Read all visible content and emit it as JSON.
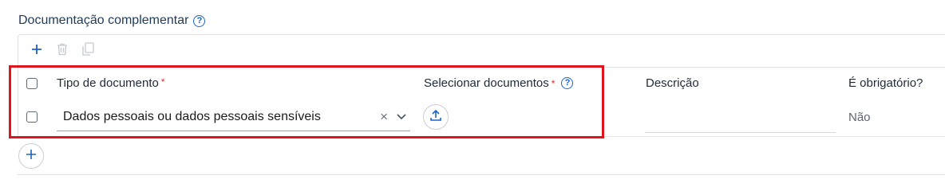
{
  "section": {
    "title": "Documentação complementar",
    "help_icon": "question-circle-icon"
  },
  "toolbar": {
    "add_icon": "plus-icon",
    "delete_icon": "trash-icon",
    "copy_icon": "copy-icon"
  },
  "table": {
    "columns": [
      {
        "label": "Tipo de documento",
        "required": "*"
      },
      {
        "label": "Selecionar documentos",
        "required": "*"
      },
      {
        "label": "Descrição"
      },
      {
        "label": "É obrigatório?"
      }
    ],
    "rows": [
      {
        "tipo_documento": "Dados pessoais ou dados pessoais sensíveis",
        "clear_symbol": "×",
        "upload_icon": "upload-icon",
        "descricao": "",
        "obrigatorio": "Não"
      }
    ]
  },
  "add_row": {
    "icon": "plus-icon"
  },
  "colors": {
    "accent": "#1d63c5",
    "highlight": "#e0141c",
    "required": "#d32f2f"
  }
}
